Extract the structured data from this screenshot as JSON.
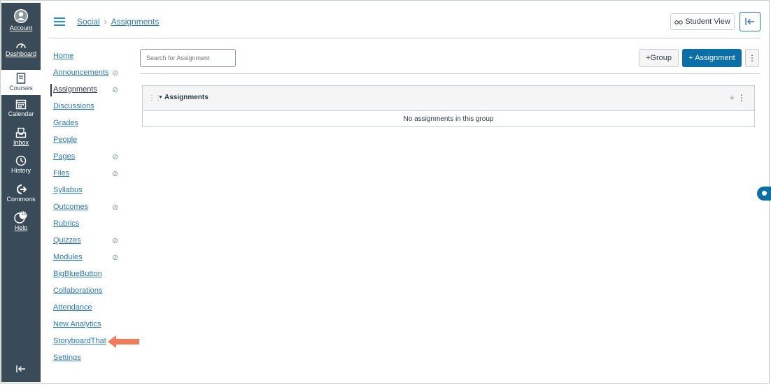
{
  "global_nav": {
    "account": "Account",
    "dashboard": "Dashboard",
    "courses": "Courses",
    "calendar": "Calendar",
    "inbox": "Inbox",
    "history": "History",
    "commons": "Commons",
    "help": "Help",
    "help_badge": "10"
  },
  "header": {
    "crumb_course": "Social",
    "crumb_separator": "›",
    "crumb_page": "Assignments",
    "student_view": "Student View"
  },
  "course_nav": {
    "items": [
      {
        "label": "Home"
      },
      {
        "label": "Announcements"
      },
      {
        "label": "Assignments"
      },
      {
        "label": "Discussions"
      },
      {
        "label": "Grades"
      },
      {
        "label": "People"
      },
      {
        "label": "Pages"
      },
      {
        "label": "Files"
      },
      {
        "label": "Syllabus"
      },
      {
        "label": "Outcomes"
      },
      {
        "label": "Rubrics"
      },
      {
        "label": "Quizzes"
      },
      {
        "label": "Modules"
      },
      {
        "label": "BigBlueButton"
      },
      {
        "label": "Collaborations"
      },
      {
        "label": "Attendance"
      },
      {
        "label": "New Analytics"
      },
      {
        "label": "StoryboardThat"
      },
      {
        "label": "Settings"
      }
    ],
    "hidden_eye_glyph": "⊘"
  },
  "toolbar": {
    "search_placeholder": "Search for Assignment",
    "group_button": "+Group",
    "assignment_button": "+ Assignment",
    "kebab": "⋮"
  },
  "group": {
    "title": "Assignments",
    "empty_message": "No assignments in this group",
    "add": "+",
    "menu": "⋮",
    "drag": "⋮⋮",
    "caret": "▼"
  },
  "colors": {
    "global_nav_bg": "#394b58",
    "link": "#2b7abc",
    "primary_button": "#0b6fa7",
    "arrow": "#f07c5b"
  }
}
